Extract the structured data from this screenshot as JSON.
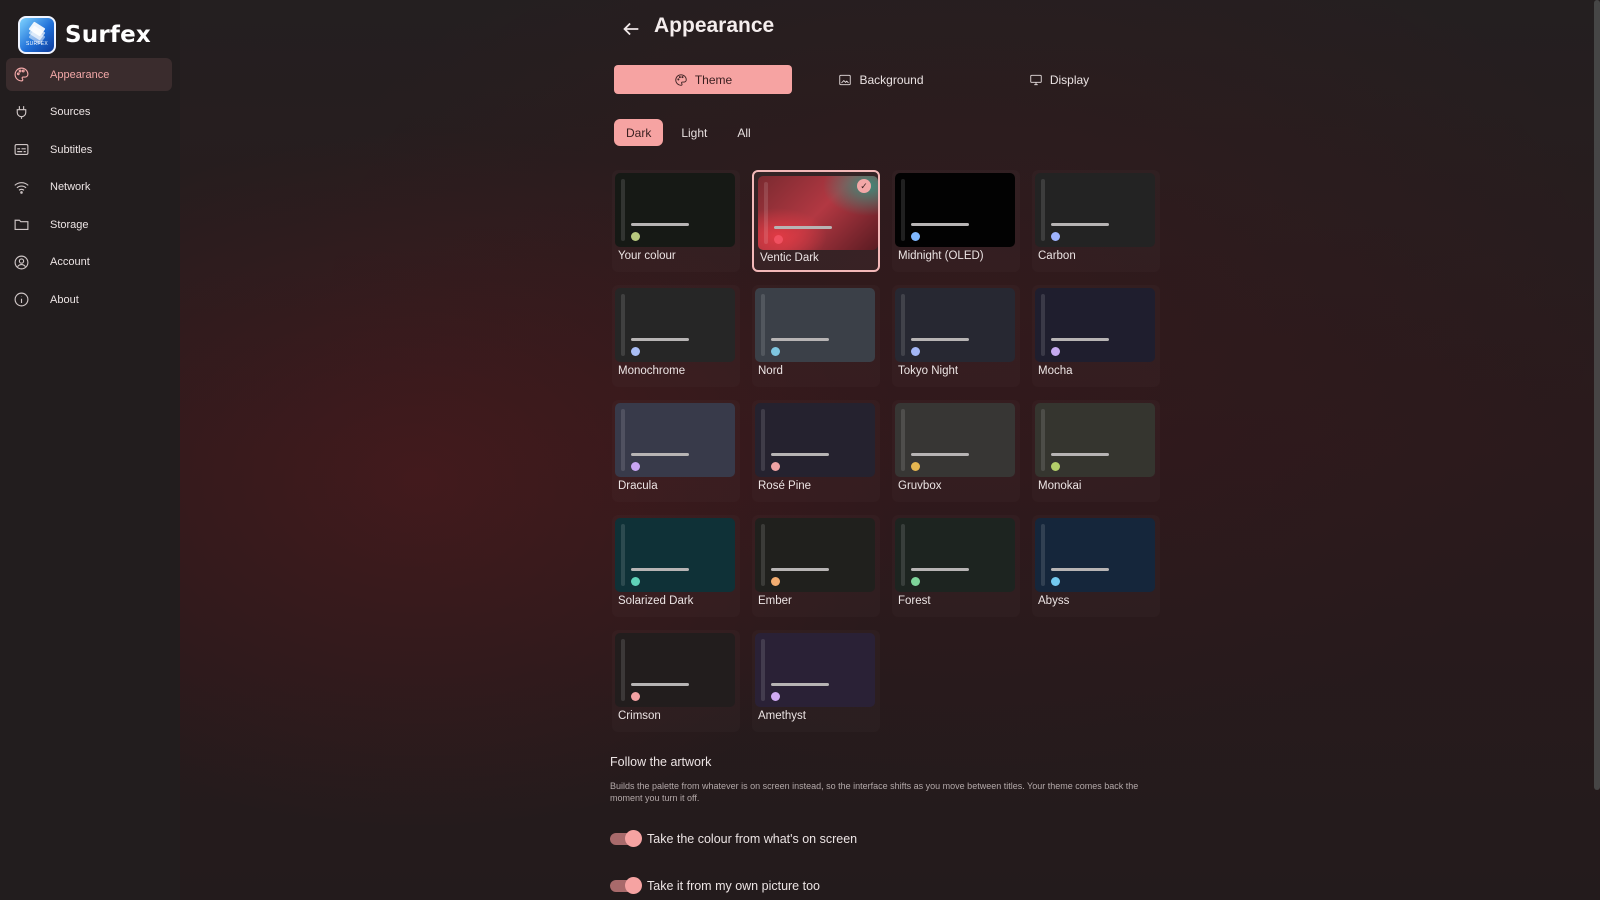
{
  "app": {
    "name": "Surfex",
    "logo_micro": "SURFEX"
  },
  "sidebar": {
    "items": [
      {
        "label": "Appearance",
        "icon": "palette-icon",
        "active": true
      },
      {
        "label": "Sources",
        "icon": "plug-icon",
        "active": false
      },
      {
        "label": "Subtitles",
        "icon": "subtitles-icon",
        "active": false
      },
      {
        "label": "Network",
        "icon": "wifi-icon",
        "active": false
      },
      {
        "label": "Storage",
        "icon": "folder-icon",
        "active": false
      },
      {
        "label": "Account",
        "icon": "account-icon",
        "active": false
      },
      {
        "label": "About",
        "icon": "info-icon",
        "active": false
      }
    ]
  },
  "header": {
    "title": "Appearance"
  },
  "tabs": [
    {
      "label": "Theme",
      "active": true
    },
    {
      "label": "Background",
      "active": false
    },
    {
      "label": "Display",
      "active": false
    }
  ],
  "filters": [
    {
      "label": "Dark",
      "active": true
    },
    {
      "label": "Light",
      "active": false
    },
    {
      "label": "All",
      "active": false
    }
  ],
  "themes": [
    {
      "name": "Your colour",
      "bg": "#161915",
      "dot": "#b8c97e",
      "selected": false
    },
    {
      "name": "Ventic Dark",
      "bg": "gradient",
      "dot": "#f05060",
      "selected": true
    },
    {
      "name": "Midnight (OLED)",
      "bg": "#020202",
      "dot": "#7fb8ff",
      "selected": false
    },
    {
      "name": "Carbon",
      "bg": "#232323",
      "dot": "#9fb4ff",
      "selected": false
    },
    {
      "name": "Monochrome",
      "bg": "#262626",
      "dot": "#a9bdf5",
      "selected": false
    },
    {
      "name": "Nord",
      "bg": "#3b4048",
      "dot": "#7fc6e0",
      "selected": false
    },
    {
      "name": "Tokyo Night",
      "bg": "#272832",
      "dot": "#a4b7f6",
      "selected": false
    },
    {
      "name": "Mocha",
      "bg": "#1f1e2e",
      "dot": "#c6aaf0",
      "selected": false
    },
    {
      "name": "Dracula",
      "bg": "#383a4a",
      "dot": "#c9a6f3",
      "selected": false
    },
    {
      "name": "Rosé Pine",
      "bg": "#25222f",
      "dot": "#efa3a4",
      "selected": false
    },
    {
      "name": "Gruvbox",
      "bg": "#373634",
      "dot": "#e5b650",
      "selected": false
    },
    {
      "name": "Monokai",
      "bg": "#35352f",
      "dot": "#b4cf6a",
      "selected": false
    },
    {
      "name": "Solarized Dark",
      "bg": "#0f3137",
      "dot": "#5fd2b8",
      "selected": false
    },
    {
      "name": "Ember",
      "bg": "#20201d",
      "dot": "#f3ad71",
      "selected": false
    },
    {
      "name": "Forest",
      "bg": "#1d2420",
      "dot": "#7ed49a",
      "selected": false
    },
    {
      "name": "Abyss",
      "bg": "#15263b",
      "dot": "#73c9ef",
      "selected": false
    },
    {
      "name": "Crimson",
      "bg": "#221d1d",
      "dot": "#f4a2a3",
      "selected": false
    },
    {
      "name": "Amethyst",
      "bg": "#2a2136",
      "dot": "#d0aaf3",
      "selected": false
    }
  ],
  "follow": {
    "title": "Follow the artwork",
    "description": "Builds the palette from whatever is on screen instead, so the interface shifts as you move between titles. Your theme comes back the moment you turn it off.",
    "toggles": [
      {
        "label": "Take the colour from what's on screen",
        "on": true
      },
      {
        "label": "Take it from my own picture too",
        "on": true
      }
    ]
  },
  "colors": {
    "accent": "#f6a3a2",
    "sidebar_bg": "#221d1e"
  }
}
